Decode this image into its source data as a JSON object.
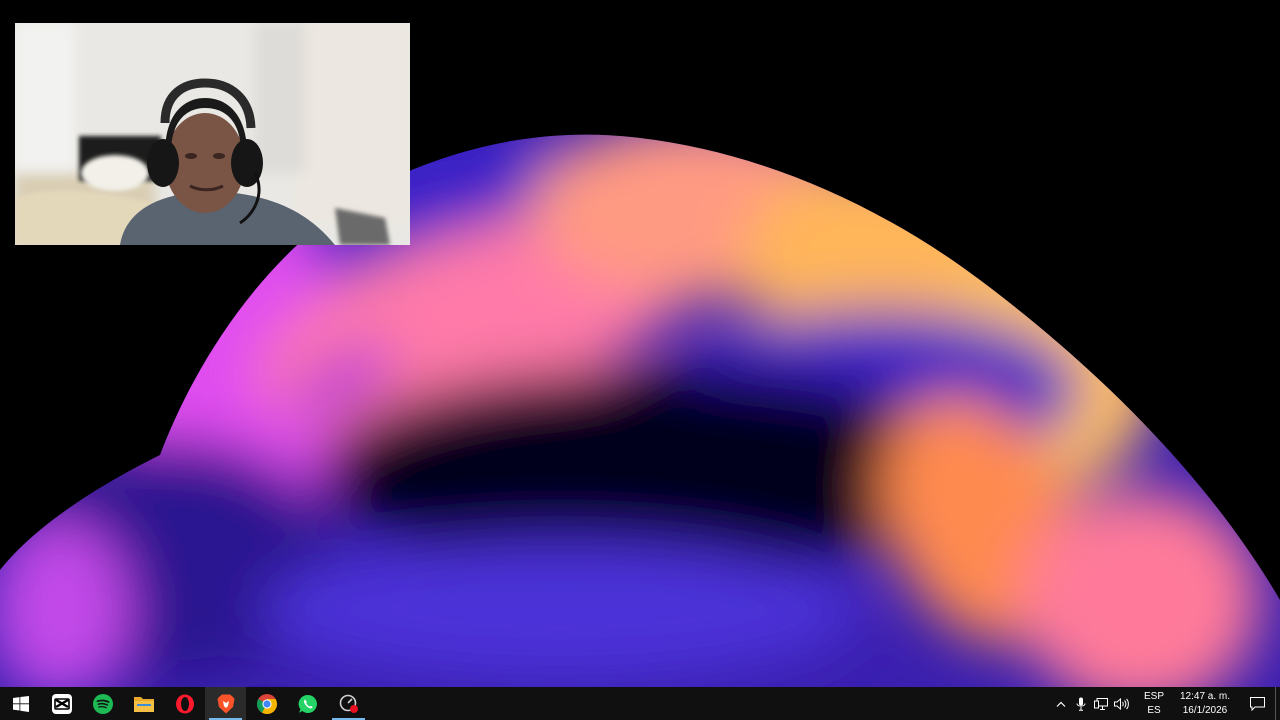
{
  "taskbar": {
    "apps": [
      {
        "name": "Start",
        "icon": "windows-logo-icon"
      },
      {
        "name": "CapCut",
        "icon": "capcut-icon"
      },
      {
        "name": "Spotify",
        "icon": "spotify-icon"
      },
      {
        "name": "File Explorer",
        "icon": "folder-icon"
      },
      {
        "name": "Opera",
        "icon": "opera-icon"
      },
      {
        "name": "Brave",
        "icon": "brave-icon"
      },
      {
        "name": "Google Chrome",
        "icon": "chrome-icon"
      },
      {
        "name": "WhatsApp",
        "icon": "whatsapp-icon"
      },
      {
        "name": "Screen Recorder",
        "icon": "recorder-icon"
      }
    ],
    "tray": {
      "language_top": "ESP",
      "language_bottom": "ES",
      "time": "12:47 a. m.",
      "date": "16/1/2026"
    }
  },
  "colors": {
    "taskbar_bg": "#101010",
    "accent": "#76b9ed",
    "spotify": "#1db954",
    "opera": "#ff1b2d",
    "brave": "#fb542b",
    "whatsapp": "#25d366",
    "folder": "#f4c145"
  }
}
